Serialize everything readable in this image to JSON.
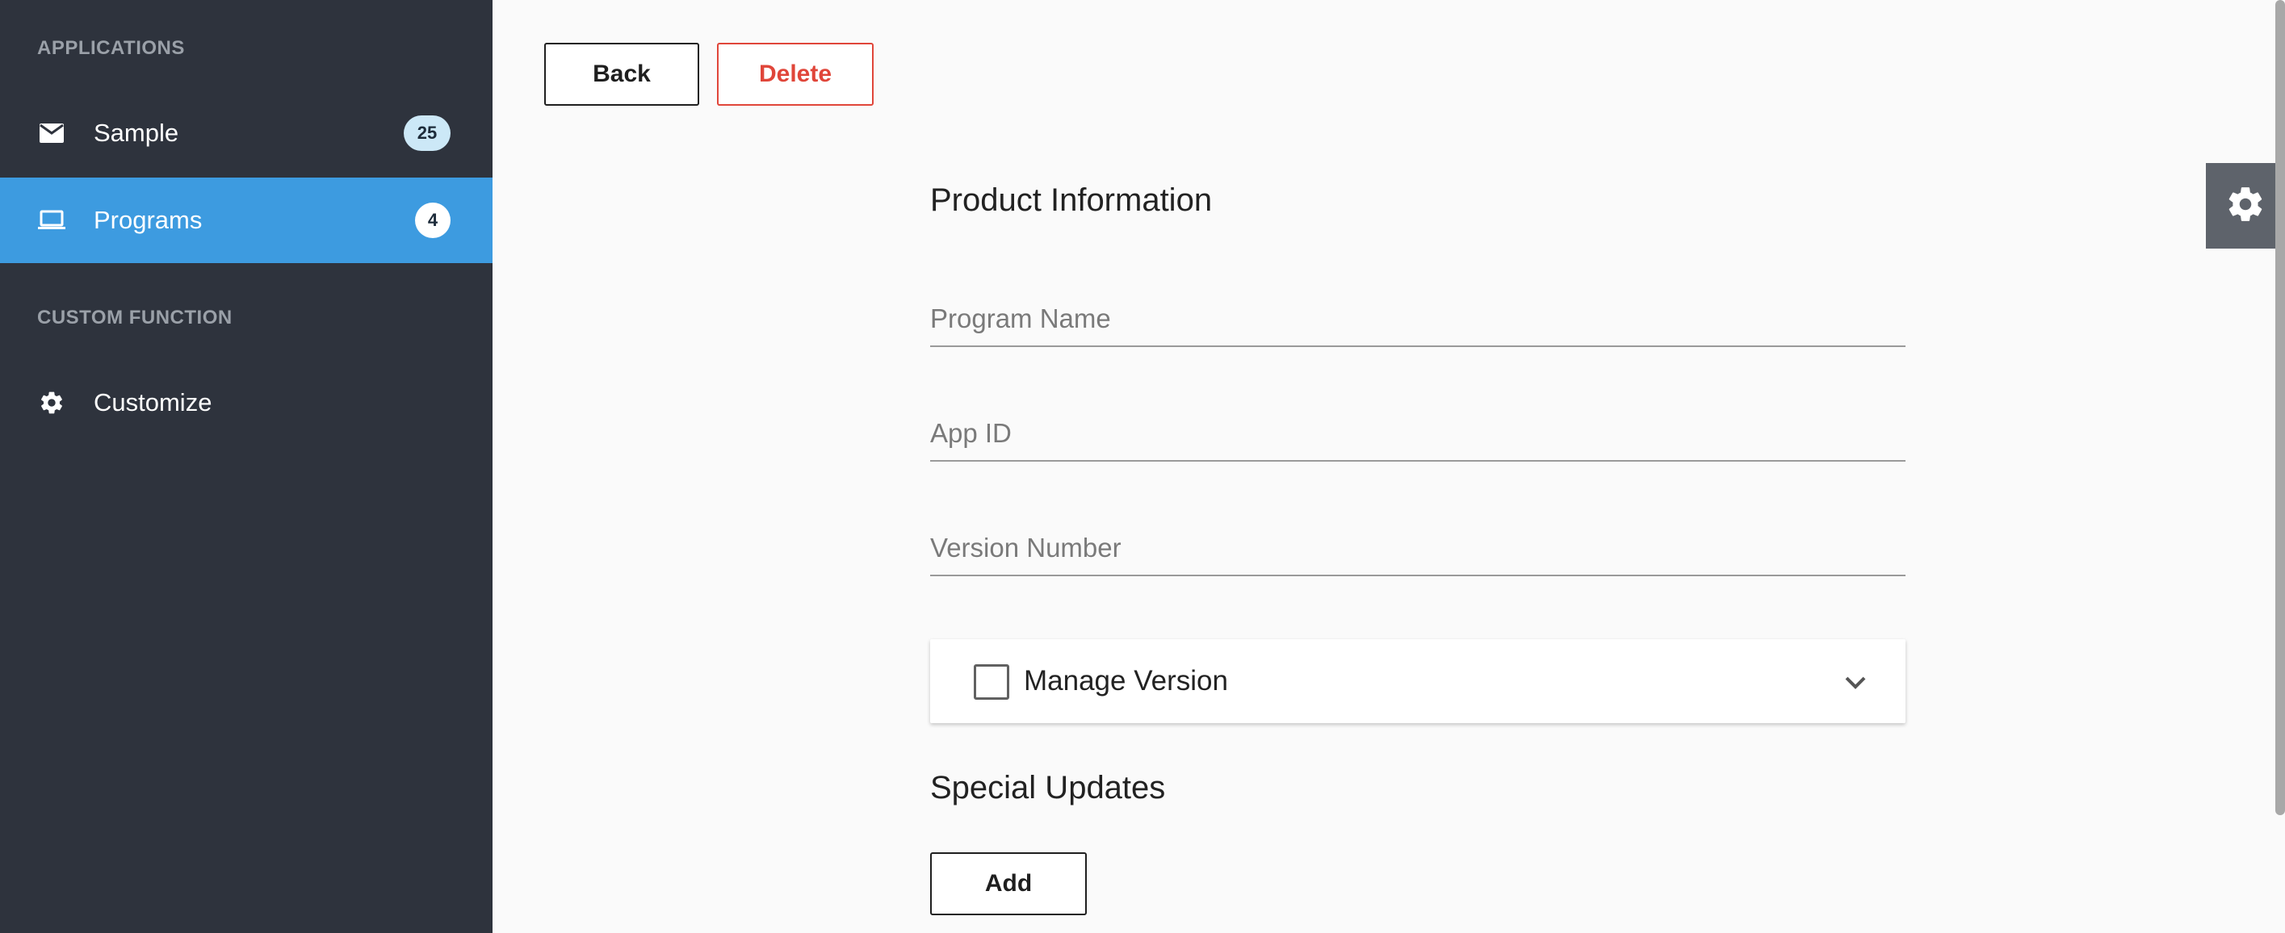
{
  "sidebar": {
    "sections": [
      {
        "header": "APPLICATIONS"
      },
      {
        "header": "CUSTOM FUNCTION"
      }
    ],
    "items": [
      {
        "label": "Sample",
        "badge": "25",
        "icon": "mail-icon"
      },
      {
        "label": "Programs",
        "badge": "4",
        "icon": "laptop-icon",
        "active": true
      },
      {
        "label": "Customize",
        "icon": "gear-icon"
      }
    ]
  },
  "toolbar": {
    "back_label": "Back",
    "delete_label": "Delete"
  },
  "form": {
    "title": "Product Information",
    "fields": [
      {
        "placeholder": "Program Name",
        "value": ""
      },
      {
        "placeholder": "App ID",
        "value": ""
      },
      {
        "placeholder": "Version Number",
        "value": ""
      }
    ],
    "manage_version": {
      "label": "Manage Version",
      "checked": false
    },
    "special_updates_title": "Special Updates",
    "add_label": "Add"
  },
  "floating": {
    "settings_icon": "gear-icon"
  },
  "colors": {
    "sidebar_bg": "#2e333d",
    "active_item": "#3d9be0",
    "delete_red": "#e0463a",
    "fab_bg": "#5e636b"
  }
}
